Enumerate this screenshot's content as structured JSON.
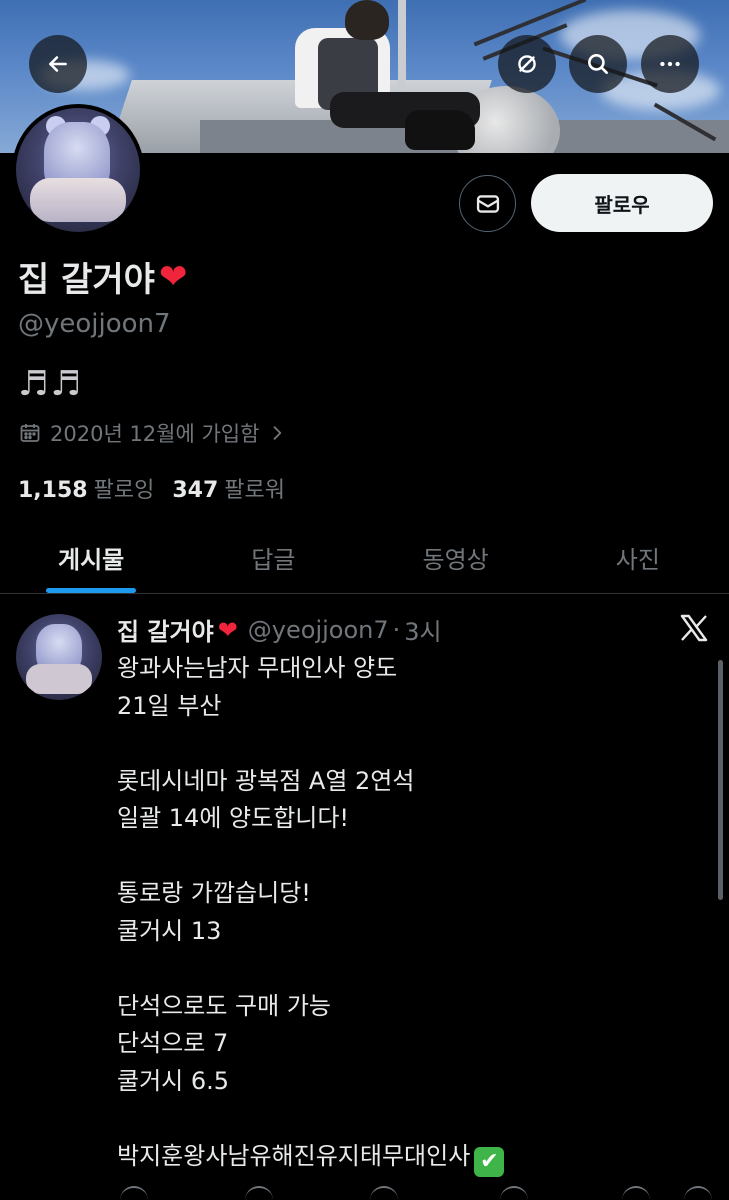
{
  "header": {
    "back_icon": "arrow-left-icon",
    "sync_icon": "circle-slash-icon",
    "search_icon": "search-icon",
    "more_icon": "more-horizontal-icon"
  },
  "profile": {
    "display_name": "집 갈거야",
    "heart": "❤",
    "handle": "@yeojjoon7",
    "bio": "♬♬",
    "joined": "2020년 12월에 가입함",
    "following_count": "1,158",
    "following_label": "팔로잉",
    "followers_count": "347",
    "followers_label": "팔로워",
    "follow_button": "팔로우",
    "message_icon": "mail-icon"
  },
  "tabs": [
    {
      "label": "게시물",
      "active": true
    },
    {
      "label": "답글",
      "active": false
    },
    {
      "label": "동영상",
      "active": false
    },
    {
      "label": "사진",
      "active": false
    }
  ],
  "post": {
    "author_name": "집 갈거야",
    "author_heart": "❤",
    "author_handle": "@yeojjoon7",
    "separator": "·",
    "time": "3시",
    "body": "왕과사는남자 무대인사 양도\n21일 부산\n\n롯데시네마 광복점 A열 2연석\n일괄 14에 양도합니다!\n\n통로랑 가깝습니당!\n쿨거시 13\n\n단석으로도 구매 가능\n단석으로 7\n쿨거시 6.5\n\n박지훈왕사남유해진유지태무대인사",
    "end_emoji": "✔",
    "source_icon": "x-logo-icon"
  },
  "colors": {
    "accent": "#1d9bf0",
    "background": "#000000",
    "text_primary": "#e7e9ea",
    "text_secondary": "#71767b",
    "heart": "#f0243a"
  }
}
